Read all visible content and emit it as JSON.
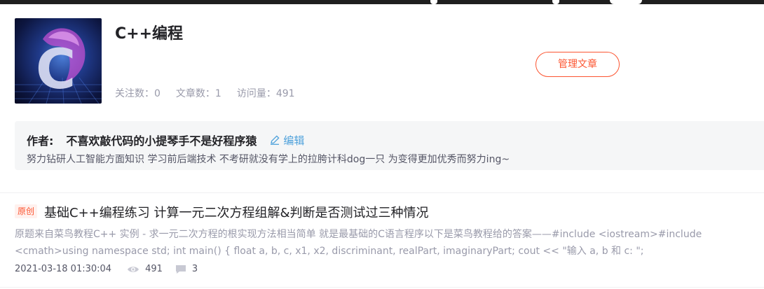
{
  "column": {
    "title": "C++编程",
    "stats": {
      "follow_label": "关注数：",
      "follow_count": "0",
      "articles_label": "文章数：",
      "articles_count": "1",
      "visits_label": "访问量：",
      "visits_count": "491"
    },
    "manage_button": "管理文章"
  },
  "author": {
    "label": "作者:",
    "name": "不喜欢敲代码的小提琴手不是好程序猿",
    "edit_label": "编辑",
    "description": "努力钻研人工智能方面知识 学习前后端技术 不考研就没有学上的拉胯计科dog一只 为变得更加优秀而努力ing~"
  },
  "articles": [
    {
      "tag": "原创",
      "title": "基础C++编程练习 计算一元二次方程组解&判断是否测试过三种情况",
      "summary": "原题来自菜鸟教程C++ 实例 - 求一元二次方程的根实现方法相当简单 就是最基础的C语言程序以下是菜鸟教程给的答案——#include <iostream>#include <cmath>using namespace std; int main() { float a, b, c, x1, x2, discriminant, realPart, imaginaryPart; cout << \"输入 a, b 和 c: \";",
      "date": "2021-03-18 01:30:04",
      "views": "491",
      "comments": "3"
    }
  ],
  "icons": {
    "edit": "pencil-icon",
    "views": "eye-icon",
    "comments": "comment-icon"
  },
  "colors": {
    "accent": "#fc5531",
    "link": "#4ea1db",
    "muted": "#999aaa"
  }
}
